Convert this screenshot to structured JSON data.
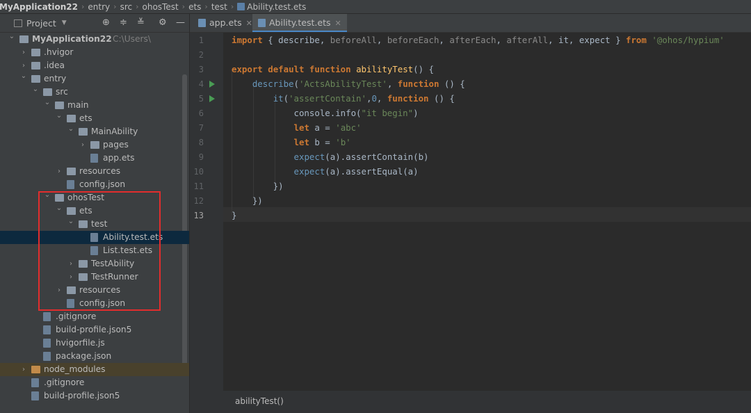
{
  "breadcrumb": [
    "MyApplication22",
    "entry",
    "src",
    "ohosTest",
    "ets",
    "test",
    "Ability.test.ets"
  ],
  "project_panel": {
    "title": "Project",
    "tools": [
      "target-icon",
      "collapse-all-icon",
      "expand-icon",
      "gear-icon",
      "minimize-icon"
    ]
  },
  "tree": [
    {
      "label": "MyApplication22",
      "hint": "C:\\Users\\",
      "level": 0,
      "type": "folder",
      "expanded": true
    },
    {
      "label": ".hvigor",
      "level": 1,
      "type": "folder",
      "expanded": false
    },
    {
      "label": ".idea",
      "level": 1,
      "type": "folder",
      "expanded": false
    },
    {
      "label": "entry",
      "level": 1,
      "type": "folder",
      "expanded": true
    },
    {
      "label": "src",
      "level": 2,
      "type": "folder",
      "expanded": true
    },
    {
      "label": "main",
      "level": 3,
      "type": "folder",
      "expanded": true
    },
    {
      "label": "ets",
      "level": 4,
      "type": "folder",
      "expanded": true
    },
    {
      "label": "MainAbility",
      "level": 5,
      "type": "folder",
      "expanded": true
    },
    {
      "label": "pages",
      "level": 6,
      "type": "folder",
      "expanded": false
    },
    {
      "label": "app.ets",
      "level": 6,
      "type": "file"
    },
    {
      "label": "resources",
      "level": 4,
      "type": "folder",
      "expanded": false
    },
    {
      "label": "config.json",
      "level": 4,
      "type": "file"
    },
    {
      "label": "ohosTest",
      "level": 3,
      "type": "folder",
      "expanded": true
    },
    {
      "label": "ets",
      "level": 4,
      "type": "folder",
      "expanded": true
    },
    {
      "label": "test",
      "level": 5,
      "type": "folder",
      "expanded": true
    },
    {
      "label": "Ability.test.ets",
      "level": 6,
      "type": "file",
      "selected": true
    },
    {
      "label": "List.test.ets",
      "level": 6,
      "type": "file"
    },
    {
      "label": "TestAbility",
      "level": 5,
      "type": "folder",
      "expanded": false
    },
    {
      "label": "TestRunner",
      "level": 5,
      "type": "folder",
      "expanded": false
    },
    {
      "label": "resources",
      "level": 4,
      "type": "folder",
      "expanded": false
    },
    {
      "label": "config.json",
      "level": 4,
      "type": "file"
    },
    {
      "label": ".gitignore",
      "level": 2,
      "type": "file"
    },
    {
      "label": "build-profile.json5",
      "level": 2,
      "type": "file"
    },
    {
      "label": "hvigorfile.js",
      "level": 2,
      "type": "file"
    },
    {
      "label": "package.json",
      "level": 2,
      "type": "file"
    },
    {
      "label": "node_modules",
      "level": 1,
      "type": "folder",
      "expanded": false,
      "highlight": true
    },
    {
      "label": ".gitignore",
      "level": 1,
      "type": "file"
    },
    {
      "label": "build-profile.json5",
      "level": 1,
      "type": "file"
    }
  ],
  "tabs": [
    {
      "label": "app.ets",
      "active": false
    },
    {
      "label": "Ability.test.ets",
      "active": true
    }
  ],
  "editor": {
    "line_numbers": [
      "1",
      "2",
      "3",
      "4",
      "5",
      "6",
      "7",
      "8",
      "9",
      "10",
      "11",
      "12",
      "13"
    ],
    "lines": [
      "import { describe, beforeAll, beforeEach, afterEach, afterAll, it, expect } from '@ohos/hypium'",
      "",
      "export default function abilityTest() {",
      "    describe('ActsAbilityTest', function () {",
      "        it('assertContain',0, function () {",
      "            console.info(\"it begin\")",
      "            let a = 'abc'",
      "            let b = 'b'",
      "            expect(a).assertContain(b)",
      "            expect(a).assertEqual(a)",
      "        })",
      "    })",
      "}"
    ],
    "current_line": 13
  },
  "status_breadcrumb": "abilityTest()"
}
